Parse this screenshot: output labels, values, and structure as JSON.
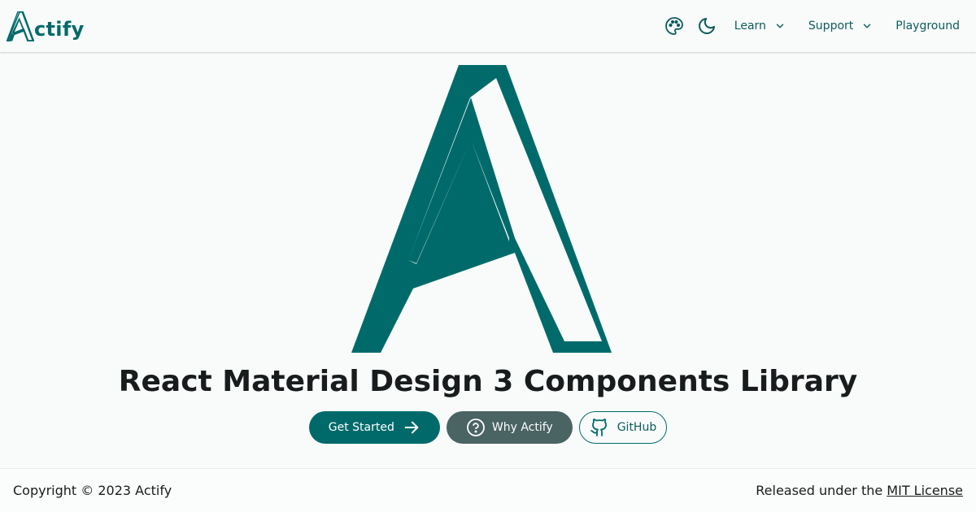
{
  "brand": {
    "name": "ctify",
    "accent": "#006a6a"
  },
  "nav": {
    "theme_icon": "palette-icon",
    "dark_mode_icon": "moon-icon",
    "learn": "Learn",
    "support": "Support",
    "playground": "Playground"
  },
  "hero": {
    "title": "React Material Design 3 Components Library",
    "get_started": "Get Started",
    "why": "Why Actify",
    "github": "GitHub"
  },
  "footer": {
    "copyright": "Copyright © 2023 Actify",
    "released_prefix": "Released under the ",
    "license_link": "MIT License"
  }
}
